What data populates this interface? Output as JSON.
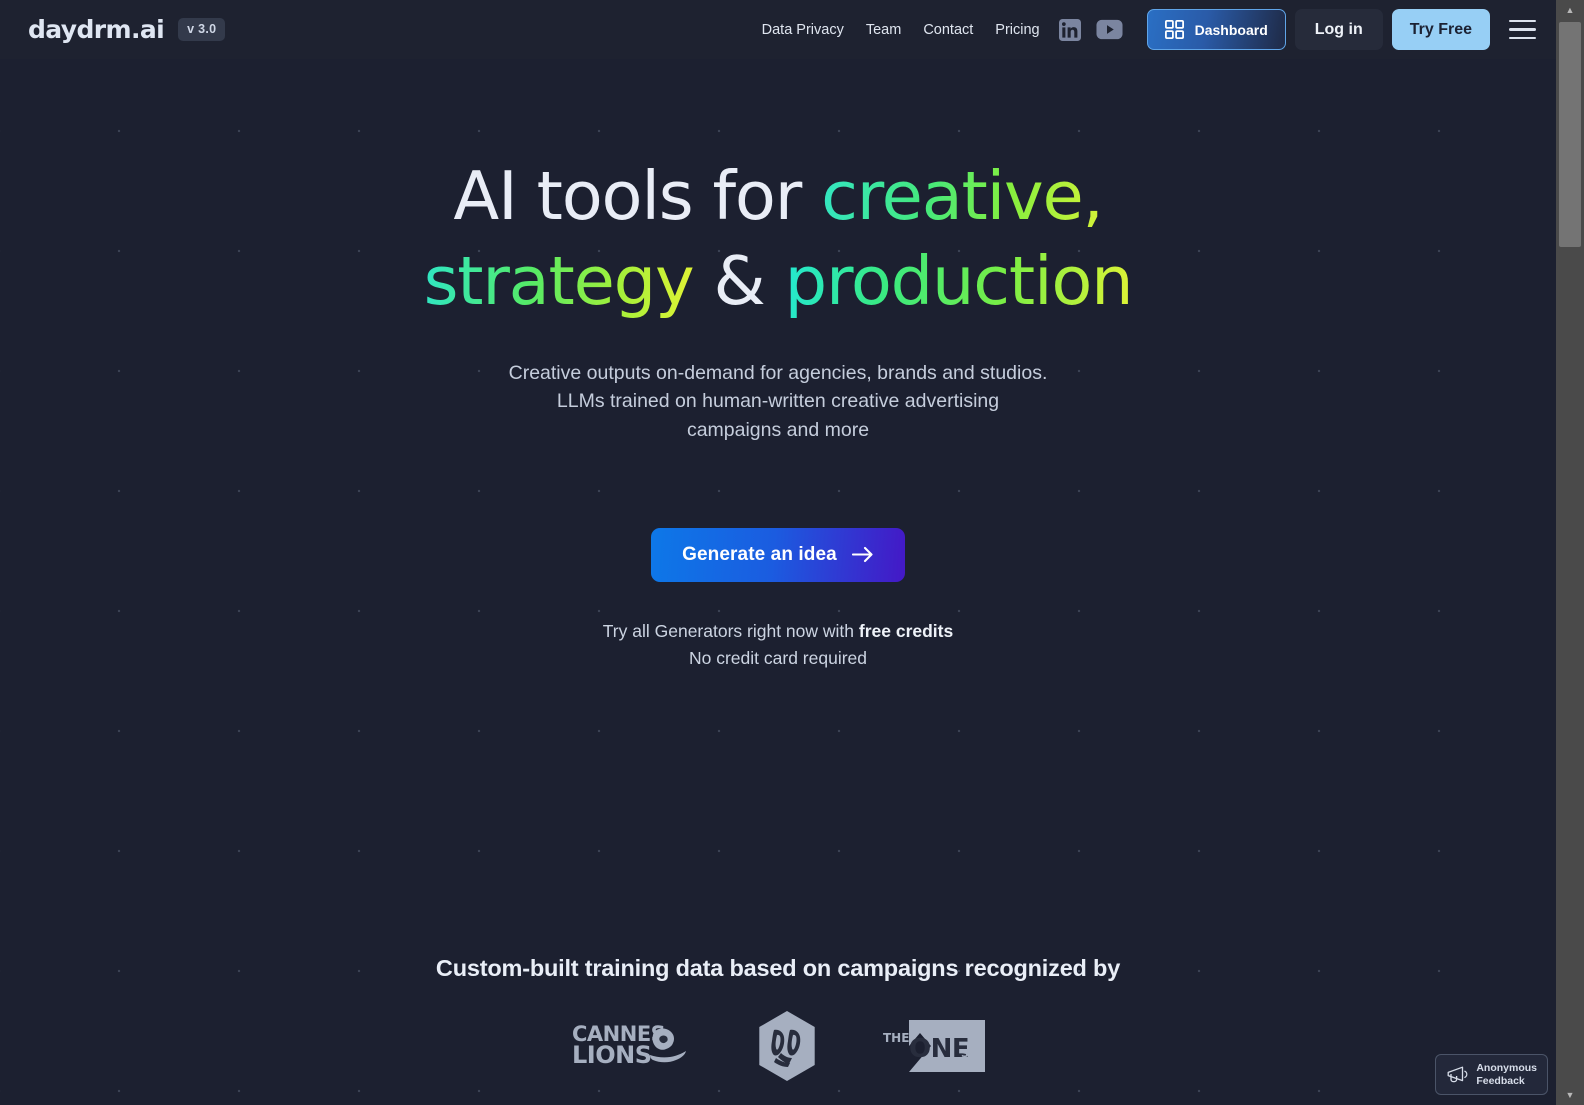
{
  "header": {
    "brand": {
      "logo_text": "daydrm.ai",
      "version_badge": "v 3.0"
    },
    "nav_links": [
      {
        "label": "Data Privacy"
      },
      {
        "label": "Team"
      },
      {
        "label": "Contact"
      },
      {
        "label": "Pricing"
      }
    ],
    "social": [
      {
        "name": "linkedin-icon",
        "label": "LinkedIn"
      },
      {
        "name": "youtube-icon",
        "label": "YouTube"
      }
    ],
    "dashboard_button": "Dashboard",
    "login_button": "Log in",
    "try_free_button": "Try Free",
    "menu_label": "Menu"
  },
  "hero": {
    "headline": {
      "line1_plain": "AI tools for ",
      "line1_accent": "creative,",
      "line2_accent_a": "strategy",
      "line2_plain": " & ",
      "line2_accent_b": "production"
    },
    "subhead": "Creative outputs on-demand for agencies, brands and studios. LLMs trained on human-written creative advertising campaigns and more",
    "cta_label": "Generate an idea",
    "credits_line1_prefix": "Try all Generators right now with ",
    "credits_line1_strong": "free credits",
    "credits_line2": "No credit card required"
  },
  "awards": {
    "title": "Custom-built training data based on campaigns recognized by",
    "logos": [
      {
        "name": "cannes-lions-logo",
        "line1": "CANNES",
        "line2": "LIONS"
      },
      {
        "name": "dandad-logo",
        "label": "D&AD"
      },
      {
        "name": "one-show-logo",
        "word_the": "THE",
        "word_one": "ONE",
        "word_show": "SHOW"
      }
    ]
  },
  "feedback": {
    "line1": "Anonymous",
    "line2": "Feedback"
  },
  "colors": {
    "page_background": "#1c2030",
    "header_background": "#1e2230",
    "accent_blue": "#2a6fc4",
    "try_free_blue": "#97cff5",
    "gradient_start": "#33e5c4",
    "gradient_end": "#d6f238",
    "cta_gradient_start": "#0d78e8",
    "cta_gradient_end": "#4418c6"
  }
}
